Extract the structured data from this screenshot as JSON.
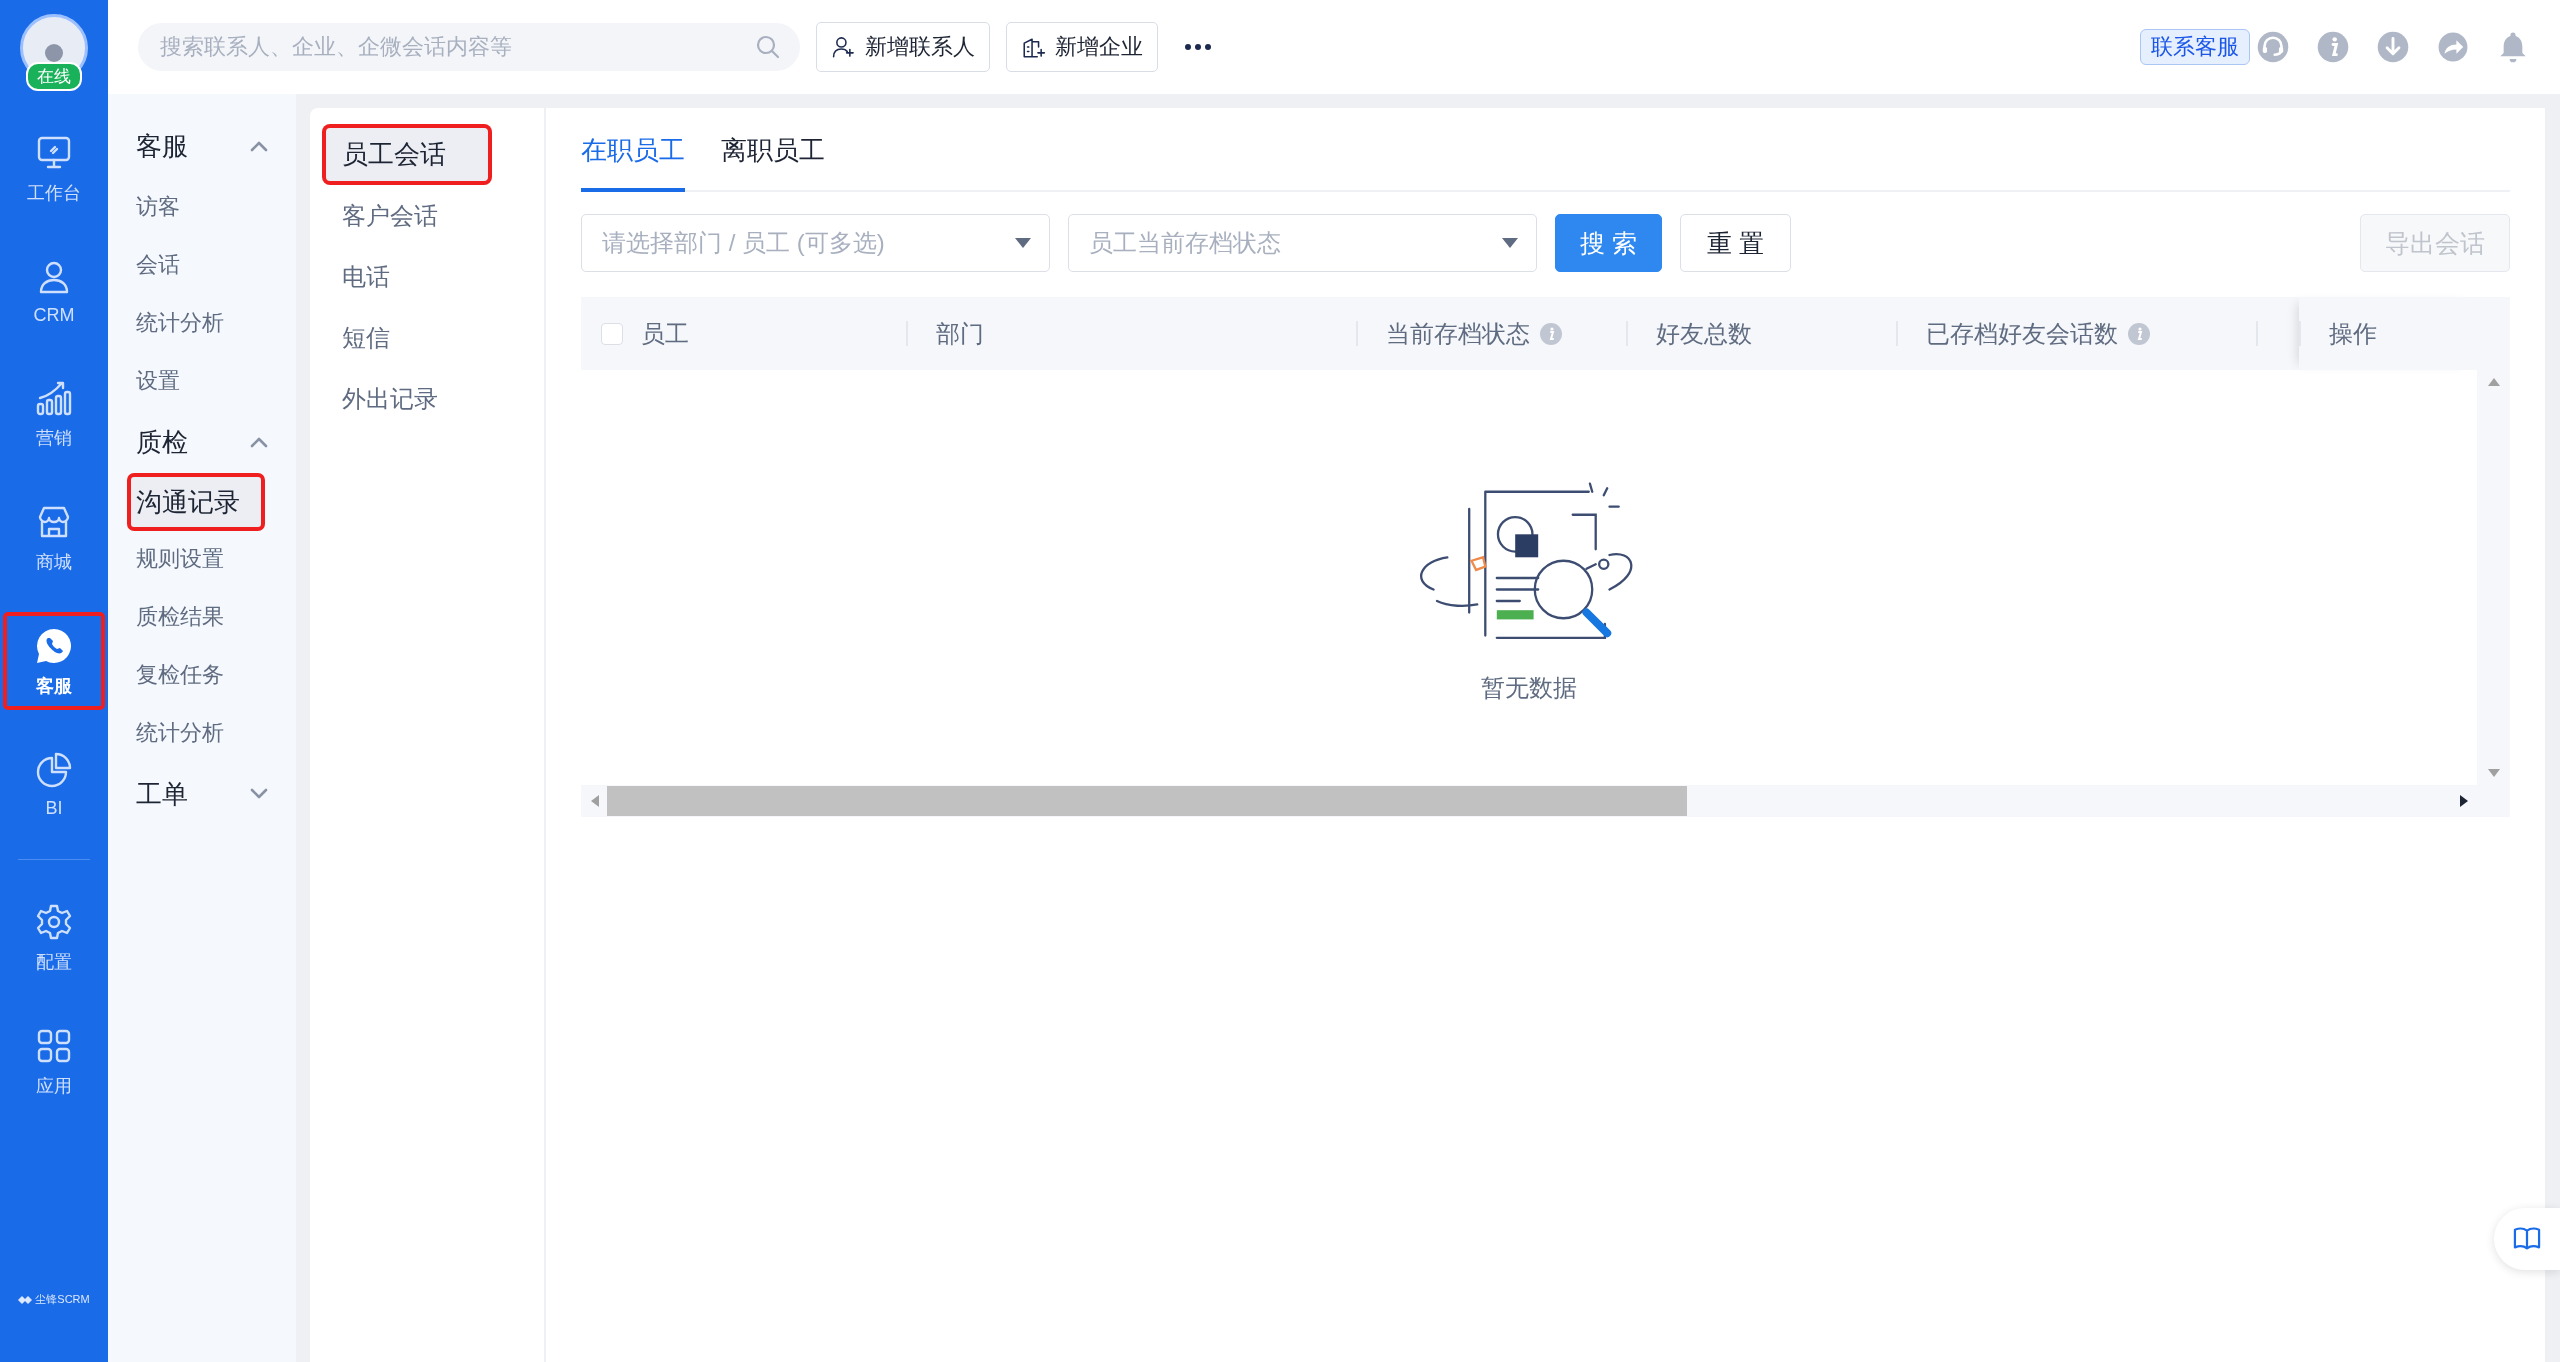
{
  "rail": {
    "avatar_status": "在线",
    "items": [
      {
        "label": "工作台",
        "selected": false,
        "highlighted": false
      },
      {
        "label": "CRM",
        "selected": false,
        "highlighted": false
      },
      {
        "label": "营销",
        "selected": false,
        "highlighted": false
      },
      {
        "label": "商城",
        "selected": false,
        "highlighted": false
      },
      {
        "label": "客服",
        "selected": true,
        "highlighted": true
      },
      {
        "label": "BI",
        "selected": false,
        "highlighted": false
      }
    ],
    "bottom_items": [
      {
        "label": "配置"
      },
      {
        "label": "应用"
      }
    ],
    "brand": "尘锋SCRM"
  },
  "topbar": {
    "search": {
      "placeholder": "搜索联系人、企业、企微会话内容等"
    },
    "buttons": [
      {
        "label": "新增联系人"
      },
      {
        "label": "新增企业"
      }
    ],
    "support_tooltip": "联系客服"
  },
  "menu": {
    "groups": [
      {
        "label": "客服",
        "expanded": true,
        "items": [
          {
            "label": "访客",
            "selected": false,
            "highlighted": false
          },
          {
            "label": "会话",
            "selected": false,
            "highlighted": false
          },
          {
            "label": "统计分析",
            "selected": false,
            "highlighted": false
          },
          {
            "label": "设置",
            "selected": false,
            "highlighted": false
          }
        ]
      },
      {
        "label": "质检",
        "expanded": true,
        "items": [
          {
            "label": "沟通记录",
            "selected": true,
            "highlighted": true
          },
          {
            "label": "规则设置",
            "selected": false,
            "highlighted": false
          },
          {
            "label": "质检结果",
            "selected": false,
            "highlighted": false
          },
          {
            "label": "复检任务",
            "selected": false,
            "highlighted": false
          },
          {
            "label": "统计分析",
            "selected": false,
            "highlighted": false
          }
        ]
      },
      {
        "label": "工单",
        "expanded": false
      }
    ]
  },
  "pagenav": {
    "items": [
      {
        "label": "员工会话",
        "selected": true,
        "highlighted": true
      },
      {
        "label": "客户会话",
        "selected": false,
        "highlighted": false
      },
      {
        "label": "电话",
        "selected": false,
        "highlighted": false
      },
      {
        "label": "短信",
        "selected": false,
        "highlighted": false
      },
      {
        "label": "外出记录",
        "selected": false,
        "highlighted": false
      }
    ]
  },
  "tabs": [
    {
      "label": "在职员工",
      "selected": true
    },
    {
      "label": "离职员工",
      "selected": false
    }
  ],
  "filters": {
    "department": {
      "placeholder": "请选择部门 / 员工 (可多选)"
    },
    "status": {
      "placeholder": "员工当前存档状态"
    }
  },
  "search_button": "搜 索",
  "reset_button": "重 置",
  "export_button": {
    "label": "导出会话",
    "disabled": true
  },
  "table": {
    "select_all_checked": false,
    "columns": [
      {
        "label": "员工",
        "info": false
      },
      {
        "label": "部门",
        "info": false
      },
      {
        "label": "当前存档状态",
        "info": true
      },
      {
        "label": "好友总数",
        "info": false
      },
      {
        "label": "已存档好友会话数",
        "info": true
      },
      {
        "label": "操作",
        "info": false
      }
    ],
    "empty_text": "暂无数据"
  }
}
